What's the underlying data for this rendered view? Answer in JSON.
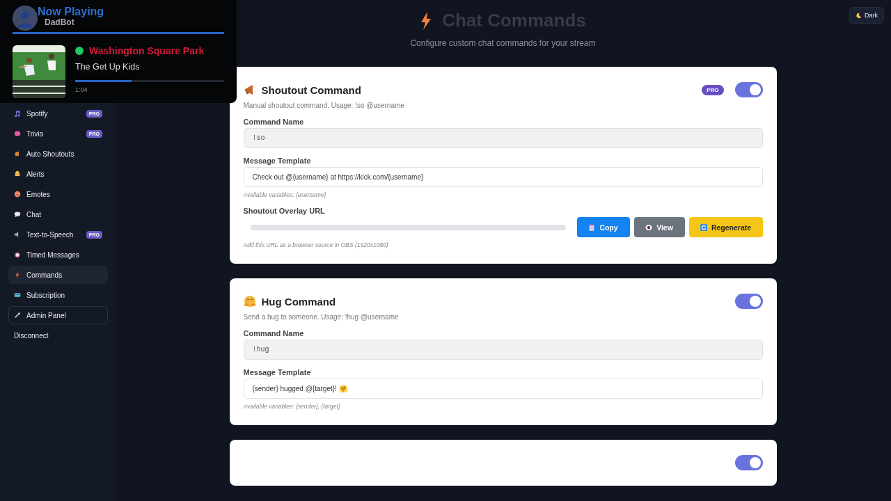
{
  "now_playing": {
    "title": "Now Playing",
    "bot_name": "DadBot",
    "track": "Washington Square Park",
    "artist": "The Get Up Kids",
    "level": 0.38,
    "time": "1:04",
    "playing": true
  },
  "sidebar": {
    "items": [
      {
        "label": "Spotify",
        "badge": "PRO",
        "selected": false,
        "hovered": false
      },
      {
        "label": "Trivia",
        "badge": "PRO",
        "selected": false,
        "hovered": false
      },
      {
        "label": "Auto Shoutouts",
        "selected": false,
        "hovered": false
      },
      {
        "label": "Alerts",
        "selected": false,
        "hovered": false
      },
      {
        "label": "Emotes",
        "selected": false,
        "hovered": false
      },
      {
        "label": "Chat",
        "selected": false,
        "hovered": false
      },
      {
        "label": "Text-to-Speech",
        "badge": "PRO",
        "selected": false,
        "hovered": false
      },
      {
        "label": "Timed Messages",
        "selected": false,
        "hovered": false
      },
      {
        "label": "Commands",
        "selected": true,
        "hovered": false
      },
      {
        "label": "Subscription",
        "selected": false,
        "hovered": false
      },
      {
        "label": "Admin Panel",
        "selected": false,
        "hovered": true
      }
    ],
    "disconnect": "Disconnect"
  },
  "header": {
    "title": "Chat Commands",
    "subtitle": "Configure custom chat commands for your stream",
    "theme_button": "Dark"
  },
  "commands": [
    {
      "kind": "shoutout",
      "title": "Shoutout Command",
      "badge": "PRO",
      "enabled": true,
      "description": "Manual shoutout command. Usage: !so @username",
      "fields": [
        {
          "label": "Command Name",
          "value": "!so",
          "disabled": true
        },
        {
          "label": "Message Template",
          "value": "Check out @{username} at https://kick.com/{username}",
          "disabled": false
        }
      ],
      "hint": "Available variables: {username}",
      "overlay": {
        "label": "Shoutout Overlay URL",
        "buttons": [
          {
            "label": "Copy",
            "kind": "primary"
          },
          {
            "label": "View",
            "kind": "secondary"
          },
          {
            "label": "Regenerate",
            "kind": "warning"
          }
        ],
        "hint": "Add this URL as a browser source in OBS (1920x1080)"
      }
    },
    {
      "kind": "hug",
      "title": "Hug Command",
      "enabled": true,
      "description": "Send a hug to someone. Usage: !hug @username",
      "fields": [
        {
          "label": "Command Name",
          "value": "!hug",
          "disabled": true
        },
        {
          "label": "Message Template",
          "value": "{sender} hugged @{target}! 🤗",
          "disabled": false
        }
      ],
      "hint": "Available variables: {sender}, {target}"
    },
    {
      "kind": "other",
      "enabled": true
    }
  ]
}
